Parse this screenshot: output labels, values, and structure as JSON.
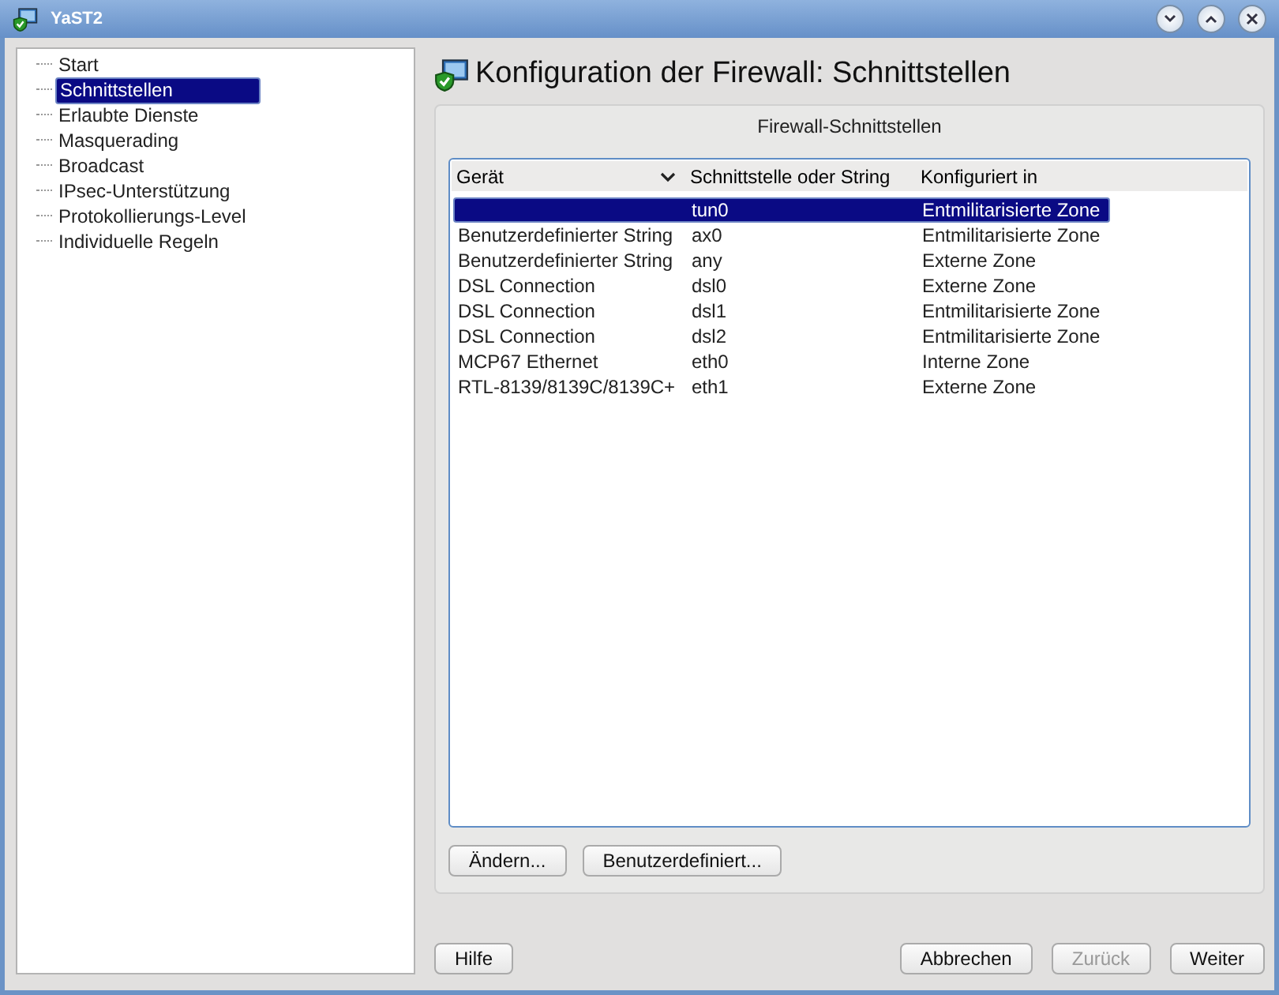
{
  "window": {
    "title": "YaST2"
  },
  "sidebar": {
    "items": [
      {
        "label": "Start",
        "selected": false
      },
      {
        "label": "Schnittstellen",
        "selected": true
      },
      {
        "label": "Erlaubte Dienste",
        "selected": false
      },
      {
        "label": "Masquerading",
        "selected": false
      },
      {
        "label": "Broadcast",
        "selected": false
      },
      {
        "label": "IPsec-Unterstützung",
        "selected": false
      },
      {
        "label": "Protokollierungs-Level",
        "selected": false
      },
      {
        "label": "Individuelle Regeln",
        "selected": false
      }
    ]
  },
  "heading": "Konfiguration der Firewall: Schnittstellen",
  "group": {
    "title": "Firewall-Schnittstellen"
  },
  "table": {
    "columns": [
      "Gerät",
      "Schnittstelle oder String",
      "Konfiguriert in"
    ],
    "rows": [
      {
        "cells": [
          "",
          "tun0",
          "Entmilitarisierte Zone"
        ],
        "selected": true
      },
      {
        "cells": [
          "Benutzerdefinierter String",
          "ax0",
          "Entmilitarisierte Zone"
        ],
        "selected": false
      },
      {
        "cells": [
          "Benutzerdefinierter String",
          "any",
          "Externe Zone"
        ],
        "selected": false
      },
      {
        "cells": [
          "DSL Connection",
          "dsl0",
          "Externe Zone"
        ],
        "selected": false
      },
      {
        "cells": [
          "DSL Connection",
          "dsl1",
          "Entmilitarisierte Zone"
        ],
        "selected": false
      },
      {
        "cells": [
          "DSL Connection",
          "dsl2",
          "Entmilitarisierte Zone"
        ],
        "selected": false
      },
      {
        "cells": [
          "MCP67 Ethernet",
          "eth0",
          "Interne Zone"
        ],
        "selected": false
      },
      {
        "cells": [
          "RTL-8139/8139C/8139C+",
          "eth1",
          "Externe Zone"
        ],
        "selected": false
      }
    ]
  },
  "table_buttons": [
    {
      "label": "Ändern...",
      "disabled": false
    },
    {
      "label": "Benutzerdefiniert...",
      "disabled": false
    }
  ],
  "help_button": {
    "label": "Hilfe",
    "disabled": false
  },
  "nav_buttons": [
    {
      "label": "Abbrechen",
      "disabled": false
    },
    {
      "label": "Zurück",
      "disabled": true
    },
    {
      "label": "Weiter",
      "disabled": false
    }
  ]
}
